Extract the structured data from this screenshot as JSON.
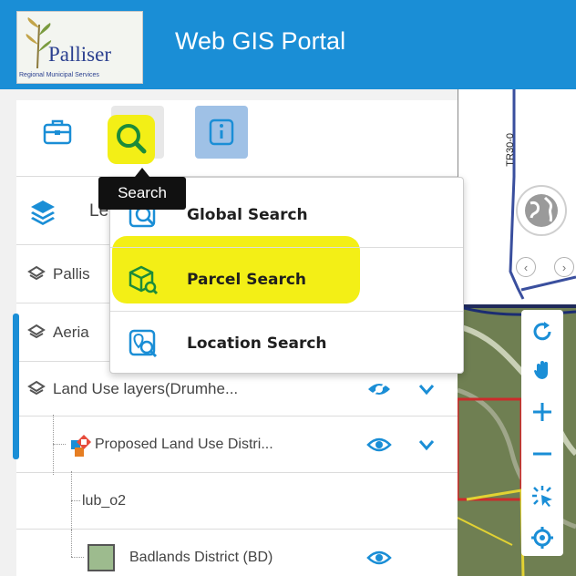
{
  "header": {
    "logo_name": "Palliser",
    "logo_subtitle": "Regional Municipal Services",
    "title": "Web GIS Portal",
    "bg_color": "#1a8ed6"
  },
  "toolbar": {
    "tools": [
      {
        "icon": "briefcase-icon"
      },
      {
        "icon": "search-icon",
        "highlighted": true
      },
      {
        "icon": "info-icon",
        "active": true
      }
    ],
    "tooltip": "Search"
  },
  "search_menu": {
    "items": [
      {
        "label": "Global Search",
        "icon": "global-search-icon"
      },
      {
        "label": "Parcel Search",
        "icon": "parcel-search-icon",
        "highlighted": true
      },
      {
        "label": "Location Search",
        "icon": "location-search-icon"
      }
    ]
  },
  "layers": {
    "header_label": "Le",
    "rows": [
      {
        "label": "Pallis"
      },
      {
        "label": "Aeria"
      },
      {
        "label": "Land Use layers(Drumhe..."
      },
      {
        "label": "Proposed Land Use Distri..."
      },
      {
        "label": "lub_o2"
      },
      {
        "label": "Badlands District (BD)",
        "swatch": "#9dbb8e"
      }
    ]
  },
  "map": {
    "road_label": "TR30-0",
    "controls": [
      "refresh-icon",
      "pan-hand-icon",
      "zoom-in-icon",
      "zoom-out-icon",
      "identify-icon",
      "locate-icon"
    ]
  },
  "colors": {
    "accent": "#1a8ed6",
    "highlight": "#f3ef16"
  }
}
